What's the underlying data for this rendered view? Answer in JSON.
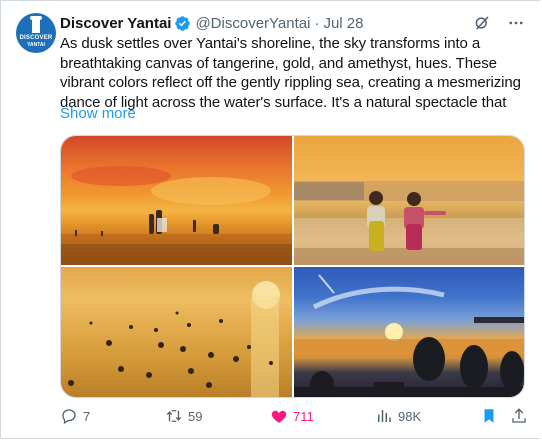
{
  "account": {
    "avatar_text_line1": "DISCOVER",
    "avatar_text_line2": "YANTAI",
    "name": "Discover Yantai",
    "handle": "@DiscoverYantai",
    "separator": "·",
    "date": "Jul 28"
  },
  "tweet": {
    "text": "As dusk settles over Yantai's shoreline, the sky transforms into a breathtaking canvas of tangerine, gold, and amethyst, hues. These vibrant colors reflect off the gently rippling sea, creating a mesmerizing dance of light across the water's surface. It's a natural spectacle that",
    "show_more": "Show more"
  },
  "media": [
    {
      "name": "sunset-beach-people-photo"
    },
    {
      "name": "two-children-on-beach-photo"
    },
    {
      "name": "swimmers-golden-sea-photo"
    },
    {
      "name": "silhouettes-watching-sunset-photo"
    }
  ],
  "actions": {
    "replies": "7",
    "reposts": "59",
    "likes": "711",
    "views": "98K"
  },
  "colors": {
    "accent": "#1d9bf0",
    "like": "#f91880",
    "muted": "#536471"
  },
  "icons": [
    "verified-badge-icon",
    "grok-icon",
    "more-icon",
    "reply-icon",
    "repost-icon",
    "like-icon",
    "views-icon",
    "bookmark-icon",
    "share-icon"
  ]
}
